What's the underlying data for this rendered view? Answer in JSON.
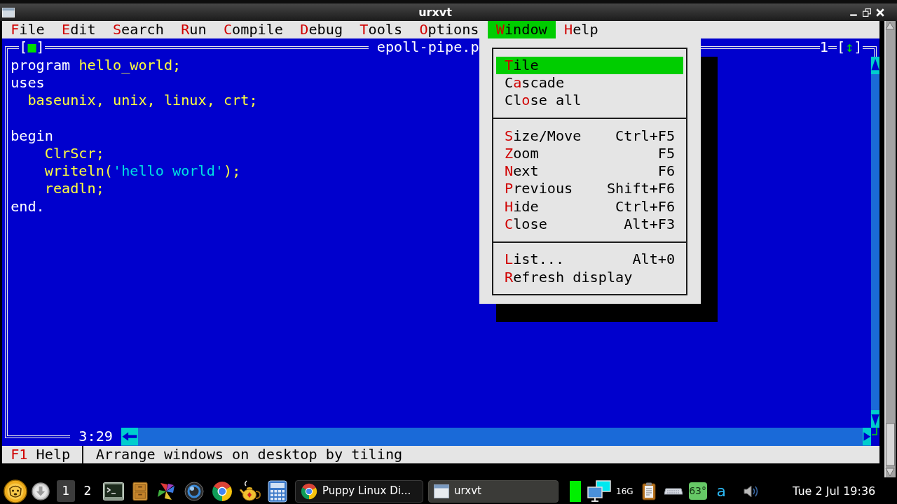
{
  "window": {
    "title": "urxvt"
  },
  "menu_bar": [
    {
      "label": "**F**ile",
      "selected": false
    },
    {
      "label": "**E**dit",
      "selected": false
    },
    {
      "label": "**S**earch",
      "selected": false
    },
    {
      "label": "**R**un",
      "selected": false
    },
    {
      "label": "**C**ompile",
      "selected": false
    },
    {
      "label": "**D**ebug",
      "selected": false
    },
    {
      "label": "**T**ools",
      "selected": false
    },
    {
      "label": "**O**ptions",
      "selected": false
    },
    {
      "label": "**W**indow",
      "selected": true
    },
    {
      "label": "**H**elp",
      "selected": false
    }
  ],
  "editor": {
    "close_button": "[**■**]",
    "title": "epoll-pipe.p",
    "number": "1",
    "zoom_button": "[**↕**]",
    "code_blocks": [
      {
        "lines": [
          {
            "tokens": [
              {
                "text": "program ",
                "kind": "reserved"
              },
              {
                "text": "hello_world;",
                "kind": "identifier"
              }
            ]
          },
          {
            "tokens": [
              {
                "text": "uses",
                "kind": "reserved"
              }
            ]
          },
          {
            "tokens": [
              {
                "text": "  baseunix, unix, linux, crt;",
                "kind": "identifier"
              }
            ]
          }
        ]
      },
      {
        "lines": [
          {
            "tokens": [
              {
                "text": "begin",
                "kind": "reserved"
              }
            ]
          },
          {
            "tokens": [
              {
                "text": "    ClrScr;",
                "kind": "identifier"
              }
            ]
          },
          {
            "tokens": [
              {
                "text": "    writeln(",
                "kind": "identifier"
              },
              {
                "text": "'hello world'",
                "kind": "string"
              },
              {
                "text": ");",
                "kind": "identifier"
              }
            ]
          },
          {
            "tokens": [
              {
                "text": "    readln;",
                "kind": "identifier"
              }
            ]
          },
          {
            "tokens": [
              {
                "text": "end.",
                "kind": "reserved"
              }
            ]
          }
        ]
      }
    ],
    "cursor_position": "3:29"
  },
  "window_menu": {
    "groups": [
      [
        {
          "label": "**T**ile",
          "selected": true
        },
        {
          "label": "C**a**scade",
          "selected": false
        },
        {
          "label": "Cl**o**se all",
          "selected": false
        }
      ],
      [
        {
          "label": "**S**ize/Move",
          "shortcut": "Ctrl+F5",
          "selected": false
        },
        {
          "label": "**Z**oom",
          "shortcut": "F5",
          "selected": false
        },
        {
          "label": "**N**ext",
          "shortcut": "F6",
          "selected": false
        },
        {
          "label": "**P**revious",
          "shortcut": "Shift+F6",
          "selected": false
        },
        {
          "label": "**H**ide",
          "shortcut": "Ctrl+F6",
          "selected": false
        },
        {
          "label": "**C**lose",
          "shortcut": "Alt+F3",
          "selected": false
        }
      ],
      [
        {
          "label": "**L**ist...",
          "shortcut": "Alt+0",
          "selected": false
        },
        {
          "label": "**R**efresh display",
          "selected": false
        }
      ]
    ]
  },
  "status_bar": {
    "key": "F1",
    "key_label": "Help",
    "hint": "Arrange windows on desktop by tiling"
  },
  "taskbar": {
    "workspaces": [
      {
        "label": "1",
        "selected": true
      },
      {
        "label": "2",
        "selected": false
      }
    ],
    "tasks": [
      {
        "label": "Puppy Linux Di...",
        "kind": "browser",
        "selected": false
      },
      {
        "label": "urxvt",
        "kind": "terminal",
        "selected": true
      }
    ],
    "memory": "16G",
    "temperature": "63°",
    "indicator": "a",
    "clock": "Tue 2 Jul 19:36"
  }
}
